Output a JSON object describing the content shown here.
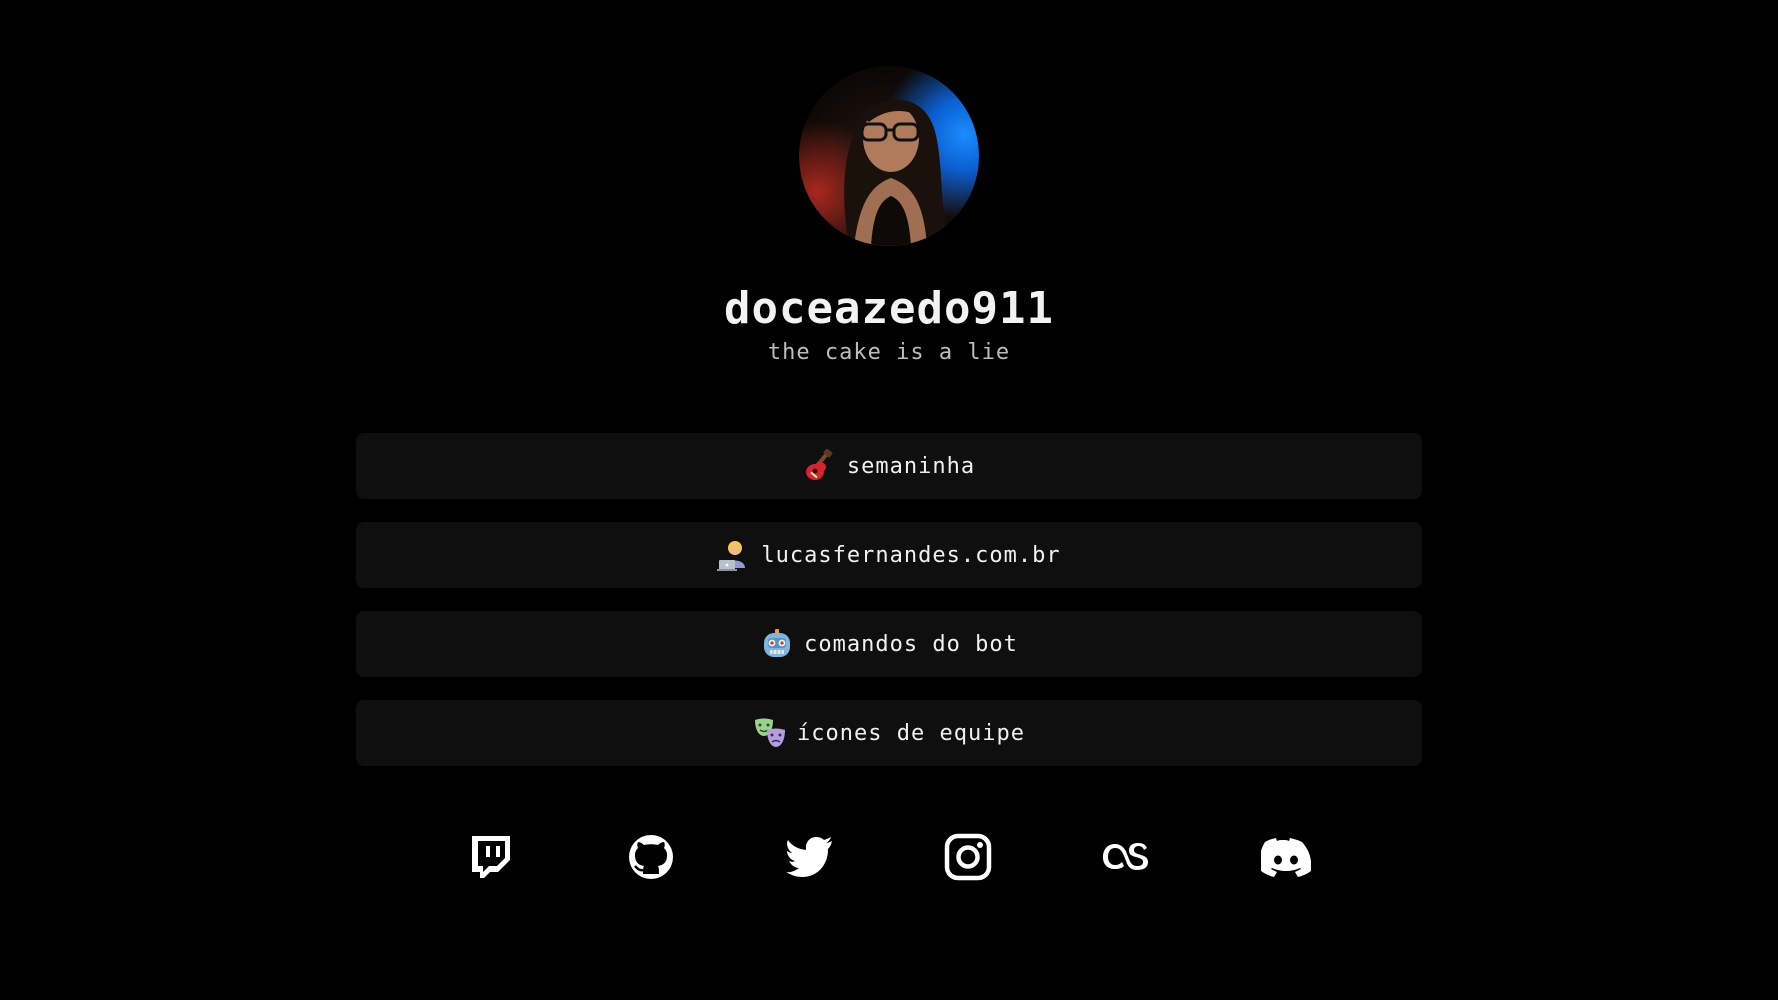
{
  "profile": {
    "username": "doceazedo911",
    "tagline": "the cake is a lie"
  },
  "links": [
    {
      "label": "semaninha",
      "icon": "guitar-icon"
    },
    {
      "label": "lucasfernandes.com.br",
      "icon": "technologist-icon"
    },
    {
      "label": "comandos do bot",
      "icon": "robot-icon"
    },
    {
      "label": "ícones de equipe",
      "icon": "performing-arts-icon"
    }
  ],
  "social": [
    {
      "name": "twitch",
      "icon": "twitch-icon"
    },
    {
      "name": "github",
      "icon": "github-icon"
    },
    {
      "name": "twitter",
      "icon": "twitter-icon"
    },
    {
      "name": "instagram",
      "icon": "instagram-icon"
    },
    {
      "name": "lastfm",
      "icon": "lastfm-icon"
    },
    {
      "name": "discord",
      "icon": "discord-icon"
    }
  ],
  "colors": {
    "background": "#000000",
    "button": "#0f0f0f",
    "text": "#f0f0f0",
    "muted": "#bdbdbd"
  }
}
